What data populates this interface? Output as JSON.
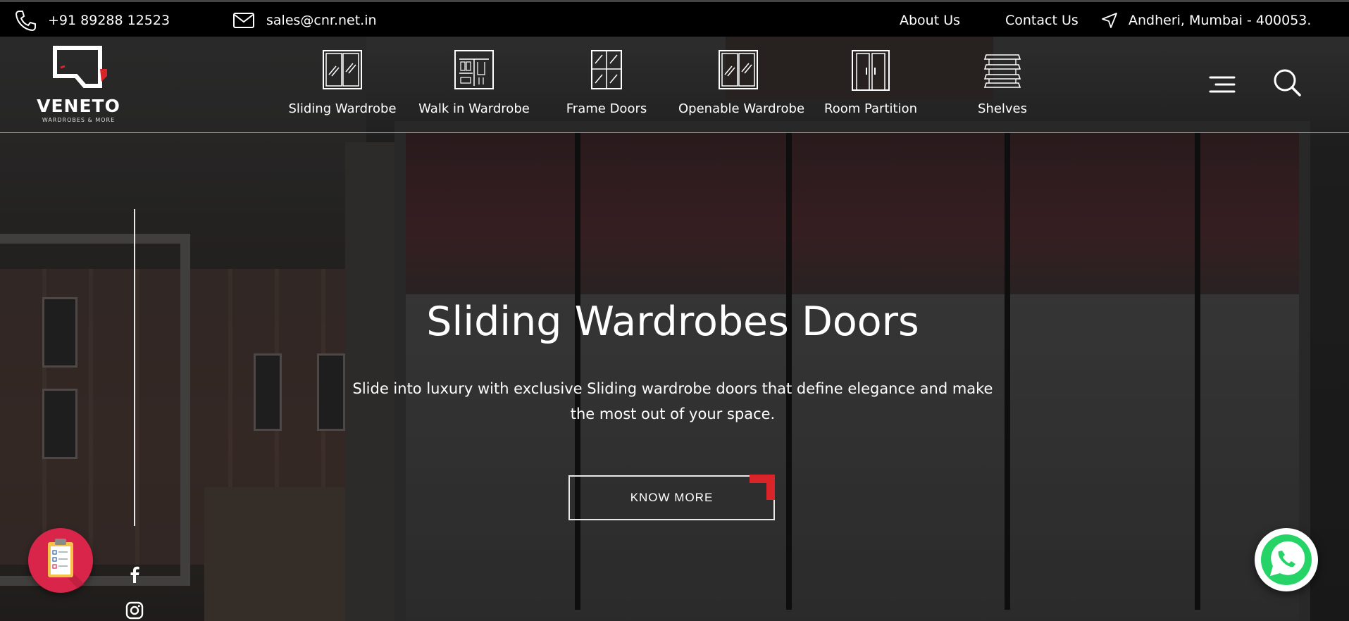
{
  "topbar": {
    "phone": "+91 89288 12523",
    "email": "sales@cnr.net.in",
    "about": "About Us",
    "contact": "Contact Us",
    "address": "Andheri, Mumbai - 400053."
  },
  "brand": {
    "name": "VENETO",
    "tagline": "WARDROBES & MORE",
    "accent_color": "#d9252a"
  },
  "nav": {
    "items": [
      {
        "label": "Sliding Wardrobe",
        "icon": "sliding-wardrobe-icon"
      },
      {
        "label": "Walk in Wardrobe",
        "icon": "walk-in-wardrobe-icon"
      },
      {
        "label": "Frame Doors",
        "icon": "frame-doors-icon"
      },
      {
        "label": "Openable Wardrobe",
        "icon": "openable-wardrobe-icon"
      },
      {
        "label": "Room Partition",
        "icon": "room-partition-icon"
      },
      {
        "label": "Shelves",
        "icon": "shelves-icon"
      }
    ]
  },
  "hero": {
    "title": "Sliding Wardrobes Doors",
    "description": "Slide into luxury with exclusive Sliding wardrobe doors that define elegance and make the most out of your space.",
    "cta": "KNOW MORE"
  },
  "floating": {
    "left_color": "#d9254a",
    "whatsapp_color": "#25d366"
  }
}
